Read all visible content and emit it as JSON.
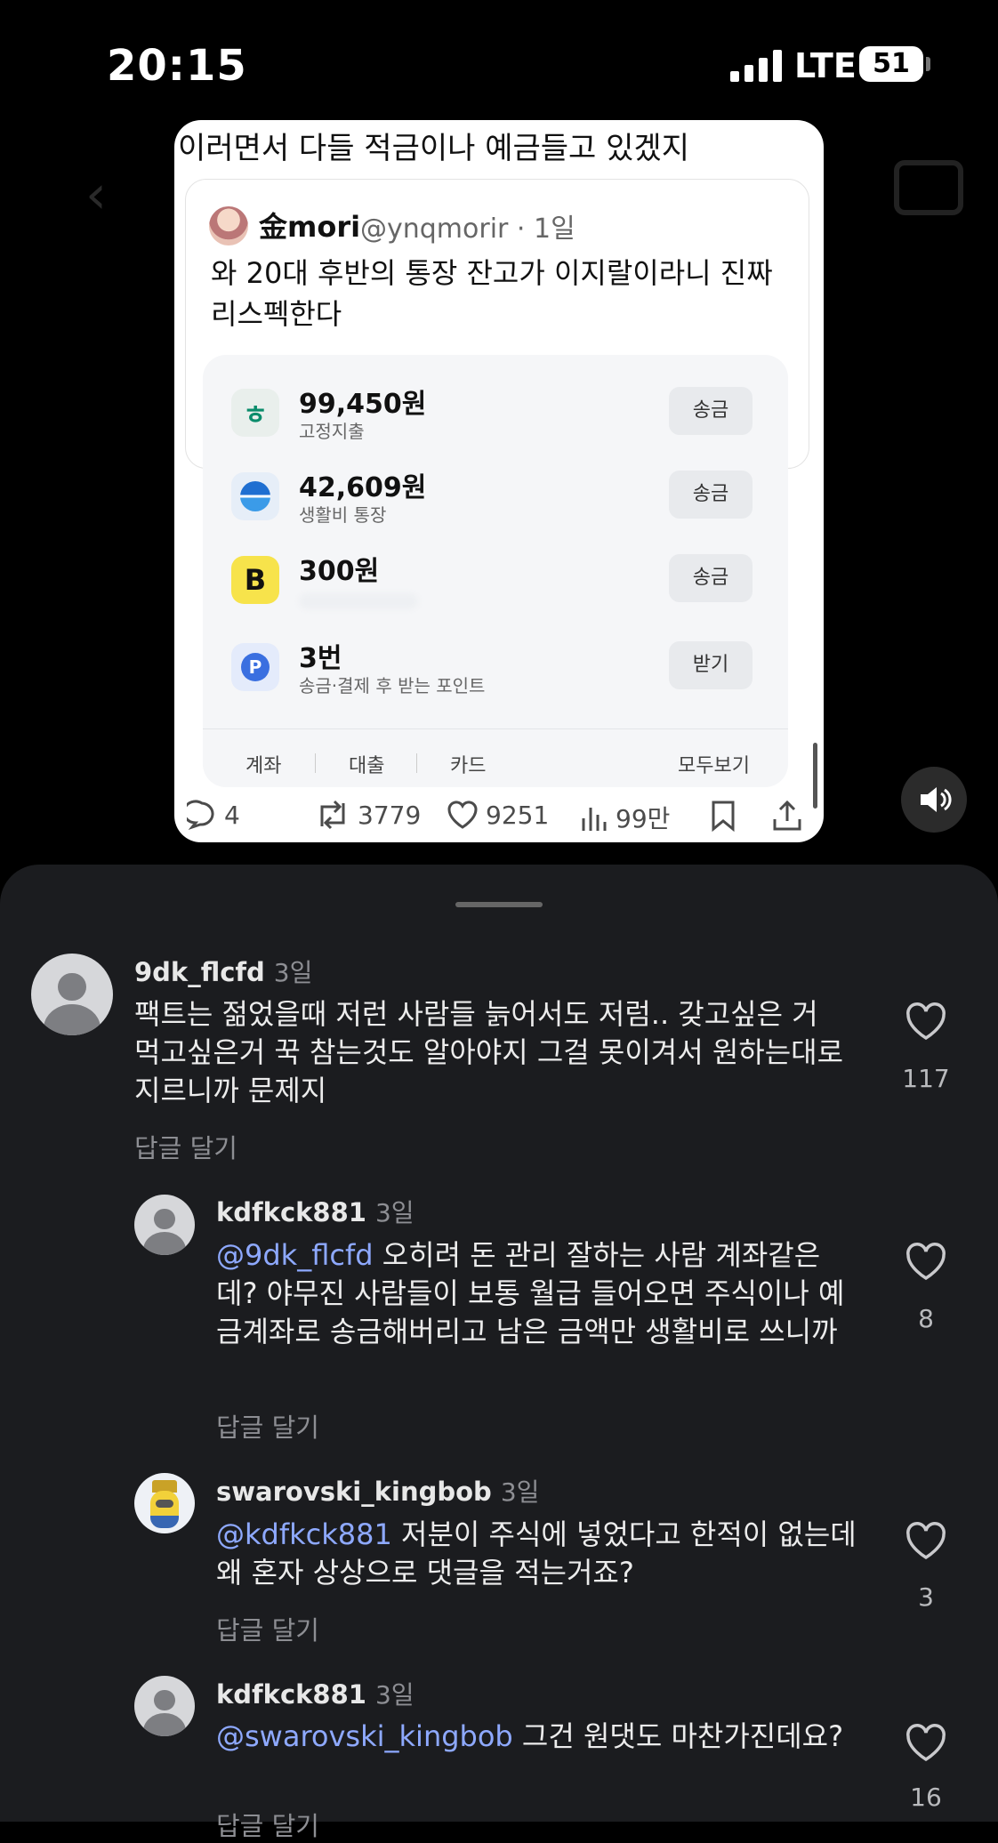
{
  "status_bar": {
    "time": "20:15",
    "network": "LTE",
    "battery": "51"
  },
  "post": {
    "caption": "이러면서 다들 적금이나 예금들고 있겠지",
    "quote": {
      "name": "金mori",
      "handle": "@ynqmorir · 1일",
      "text": "와 20대 후반의 통장 잔고가 이지랄이라니 진짜 리스펙한다"
    },
    "accounts": [
      {
        "amount": "99,450원",
        "label": "고정지출",
        "button": "송금",
        "icon": "hana-bank-icon",
        "color": "#e9efec"
      },
      {
        "amount": "42,609원",
        "label": "생활비 통장",
        "button": "송금",
        "icon": "bank-wave-icon",
        "color": "#e6eef8"
      },
      {
        "amount": "300원",
        "label": "",
        "button": "송금",
        "icon": "kakaobank-b-icon",
        "color": "#f7e34b"
      },
      {
        "amount": "3번",
        "label": "송금·결제 후 받는 포인트",
        "button": "받기",
        "icon": "points-p-icon",
        "color": "#e4ebfb"
      }
    ],
    "bank_tabs": [
      "계좌",
      "대출",
      "카드"
    ],
    "bank_more": "모두보기",
    "stats": {
      "replies": "4",
      "reposts": "3779",
      "likes": "9251",
      "views": "99만"
    }
  },
  "comments": [
    {
      "username": "9dk_flcfd",
      "date": "3일",
      "mention": "",
      "text": "팩트는 젊었을때 저런 사람들 늙어서도 저럼.. 갖고싶은 거 먹고싶은거 꾹 참는것도 알아야지 그걸 못이겨서 원하는대로 지르니까 문제지",
      "reply": "답글 달기",
      "likes": "117"
    },
    {
      "username": "kdfkck881",
      "date": "3일",
      "mention": "@9dk_flcfd",
      "text": " 오히려 돈 관리 잘하는 사람 계좌같은데? 야무진 사람들이 보통 월급 들어오면 주식이나 예금계좌로 송금해버리고 남은 금액만 생활비로 쓰니까",
      "reply": "답글 달기",
      "likes": "8"
    },
    {
      "username": "swarovski_kingbob",
      "date": "3일",
      "mention": "@kdfkck881",
      "text": " 저분이 주식에 넣었다고 한적이 없는데 왜 혼자 상상으로 댓글을 적는거죠?",
      "reply": "답글 달기",
      "likes": "3"
    },
    {
      "username": "kdfkck881",
      "date": "3일",
      "mention": "@swarovski_kingbob",
      "text": " 그건 원댓도 마찬가진데요?",
      "reply": "답글 달기",
      "likes": "16"
    }
  ]
}
